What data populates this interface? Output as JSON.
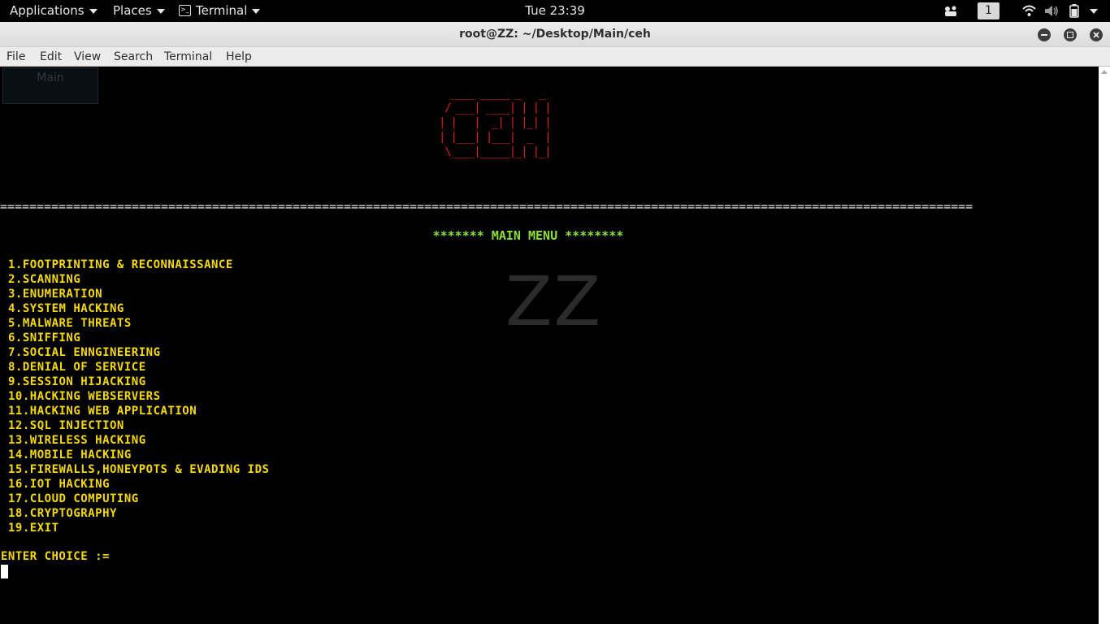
{
  "topbar": {
    "applications": "Applications",
    "places": "Places",
    "terminal": "Terminal",
    "clock": "Tue 23:39",
    "workspace": "1",
    "icons": [
      "apps-icon",
      "wifi-icon",
      "volume-icon",
      "battery-icon",
      "power-menu-icon"
    ]
  },
  "window": {
    "title": "root@ZZ: ~/Desktop/Main/ceh"
  },
  "menubar": {
    "file": "File",
    "edit": "Edit",
    "view": "View",
    "search": "Search",
    "terminal": "Terminal",
    "help": "Help"
  },
  "terminal": {
    "desktop_label": "Main",
    "ascii_logo": "  ____ _____ _   _\n / ___| ____| | | |\n| |   |  _| | |_| |\n| |___| |___|  _  |\n \\____|_____|_| |_|",
    "rule": "=====================================================================================================================================",
    "main_menu": "******* MAIN MENU ********",
    "watermark": "ZZ",
    "menu_items": [
      "1.FOOTPRINTING & RECONNAISSANCE",
      "2.SCANNING",
      "3.ENUMERATION",
      "4.SYSTEM HACKING",
      "5.MALWARE THREATS",
      "6.SNIFFING",
      "7.SOCIAL ENNGINEERING",
      "8.DENIAL OF SERVICE",
      "9.SESSION HIJACKING",
      "10.HACKING WEBSERVERS",
      "11.HACKING WEB APPLICATION",
      "12.SQL INJECTION",
      "13.WIRELESS HACKING",
      "14.MOBILE HACKING",
      "15.FIREWALLS,HONEYPOTS & EVADING IDS",
      "16.IOT HACKING",
      "17.CLOUD COMPUTING",
      "18.CRYPTOGRAPHY",
      "19.EXIT"
    ],
    "prompt": "ENTER CHOICE :="
  },
  "colors": {
    "menu_text": "#f5d90a",
    "heading": "#8ae234",
    "logo": "#e01b1b",
    "background": "#000000"
  }
}
